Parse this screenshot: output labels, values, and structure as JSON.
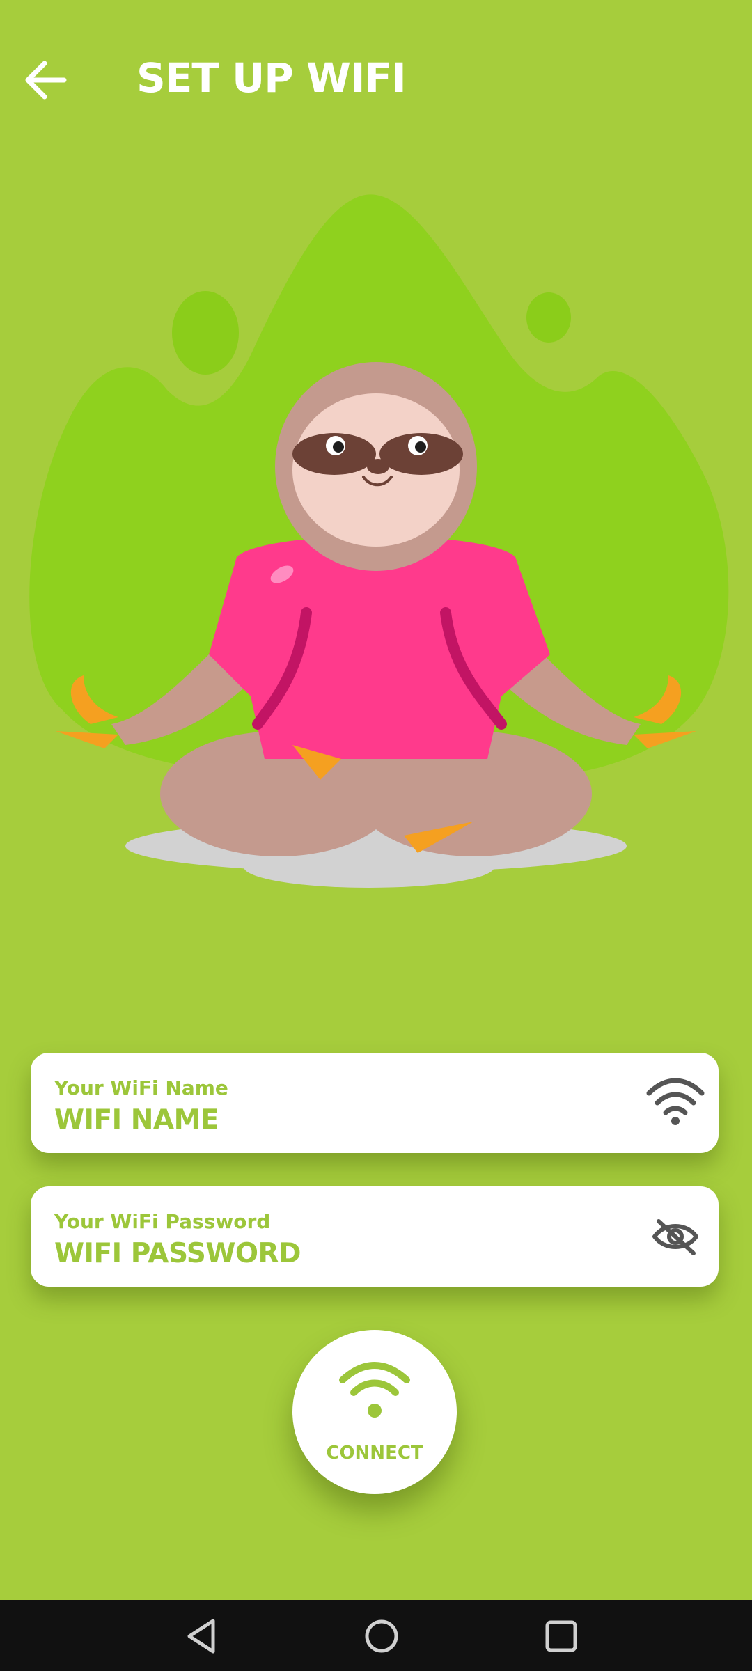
{
  "header": {
    "title": "SET UP WIFI",
    "back_icon": "arrow-left-icon"
  },
  "wifi_name": {
    "label": "Your WiFi Name",
    "value": "WIFI NAME",
    "icon": "wifi-icon"
  },
  "wifi_password": {
    "label": "Your WiFi Password",
    "value": "WIFI PASSWORD",
    "icon": "eye-off-icon"
  },
  "connect": {
    "label": "CONNECT",
    "icon": "wifi-icon"
  },
  "navbar": {
    "back_icon": "triangle-back-icon",
    "home_icon": "circle-home-icon",
    "recents_icon": "square-recents-icon"
  },
  "colors": {
    "background": "#a6cd3c",
    "accent": "#9cc63a",
    "shirt": "#ff3a8c",
    "blob": "#8fd11e"
  }
}
